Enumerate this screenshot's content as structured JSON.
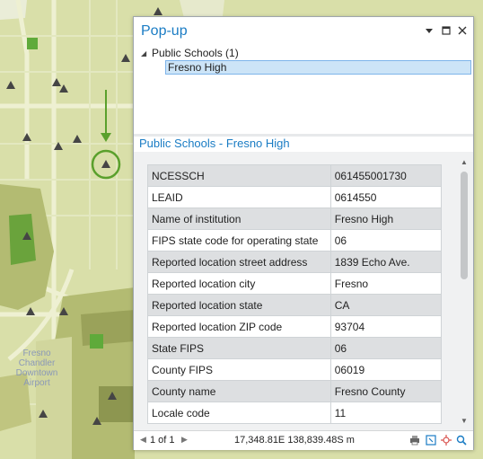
{
  "map": {
    "label": "Fresno Chandler Downtown Airport",
    "colors": {
      "background": "#d9dfa9",
      "parcel": "#b3bb72",
      "school_marker": "#444444",
      "highlight": "#5aa02c",
      "green_area": "#5faa3a"
    }
  },
  "popup": {
    "title": "Pop-up",
    "window_icons": [
      "chevron-down-icon",
      "restore-icon",
      "close-icon"
    ],
    "tree": {
      "layer_label": "Public Schools (1)",
      "feature_label": "Fresno High"
    },
    "detail_title": "Public Schools - Fresno High",
    "attributes": [
      {
        "field": "NCESSCH",
        "value": "061455001730"
      },
      {
        "field": "LEAID",
        "value": "0614550"
      },
      {
        "field": "Name of institution",
        "value": "Fresno High"
      },
      {
        "field": "FIPS state code for operating state",
        "value": "06"
      },
      {
        "field": "Reported location street address",
        "value": "1839 Echo Ave."
      },
      {
        "field": "Reported location city",
        "value": "Fresno"
      },
      {
        "field": "Reported location state",
        "value": "CA"
      },
      {
        "field": "Reported location ZIP code",
        "value": "93704"
      },
      {
        "field": "State FIPS",
        "value": "06"
      },
      {
        "field": "County FIPS",
        "value": "06019"
      },
      {
        "field": "County name",
        "value": "Fresno County"
      },
      {
        "field": "Locale code",
        "value": "11"
      }
    ],
    "status": {
      "record_count": "1 of 1",
      "coordinates": "17,348.81E 138,839.48S m"
    },
    "accent_color": "#1a7cc4"
  }
}
